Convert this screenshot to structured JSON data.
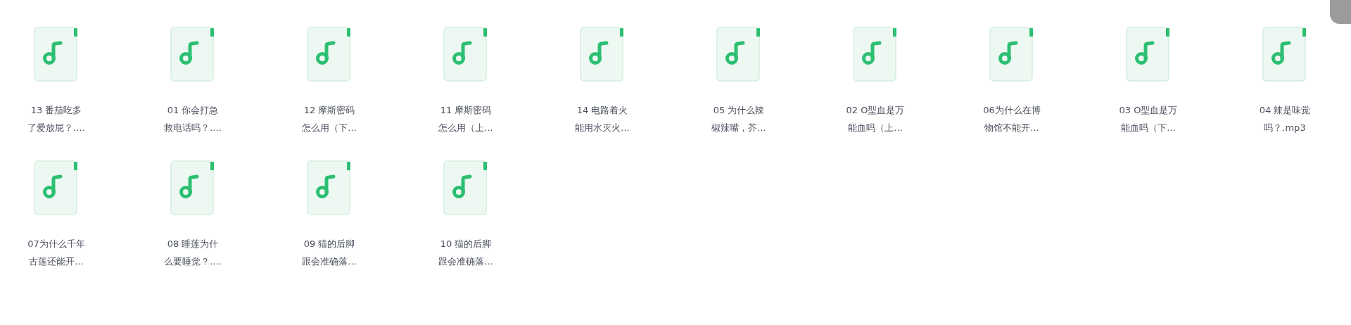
{
  "files": [
    {
      "name_lines": [
        "13 番茄吃多",
        "了爱放屁？...."
      ]
    },
    {
      "name_lines": [
        "01 你会打急",
        "救电话吗？...."
      ]
    },
    {
      "name_lines": [
        "12 摩斯密码",
        "怎么用（下..."
      ]
    },
    {
      "name_lines": [
        "11 摩斯密码",
        "怎么用（上..."
      ]
    },
    {
      "name_lines": [
        "14 电路着火",
        "能用水灭火..."
      ]
    },
    {
      "name_lines": [
        "05 为什么辣",
        "椒辣嘴，芥..."
      ]
    },
    {
      "name_lines": [
        "02 O型血是万",
        "能血吗（上..."
      ]
    },
    {
      "name_lines": [
        "06为什么在博",
        "物馆不能开..."
      ]
    },
    {
      "name_lines": [
        "03 O型血是万",
        "能血吗（下..."
      ]
    },
    {
      "name_lines": [
        "04 辣是味觉",
        "吗？.mp3"
      ]
    },
    {
      "name_lines": [
        "07为什么千年",
        "古莲还能开..."
      ]
    },
    {
      "name_lines": [
        "08 睡莲为什",
        "么要睡觉？...."
      ]
    },
    {
      "name_lines": [
        "09 猫的后脚",
        "跟会准确落..."
      ]
    },
    {
      "name_lines": [
        "10 猫的后脚",
        "跟会准确落..."
      ]
    }
  ]
}
